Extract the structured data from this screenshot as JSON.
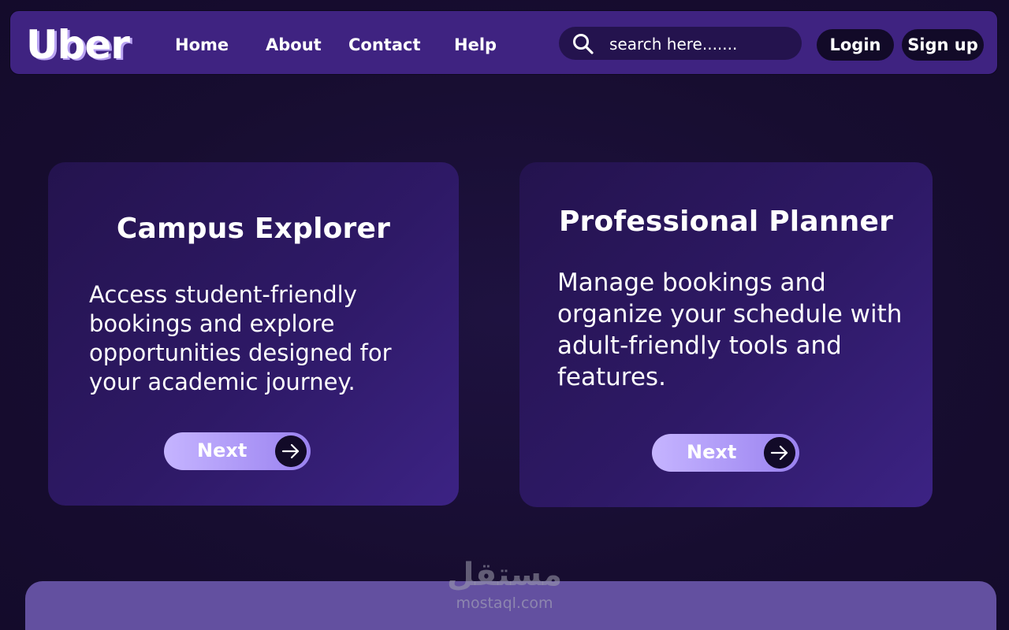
{
  "header": {
    "logo": "Uber",
    "nav": [
      "Home",
      "About",
      "Contact",
      "Help"
    ],
    "search": {
      "placeholder": "search here.......",
      "icon": "search-icon"
    },
    "login_label": "Login",
    "signup_label": "Sign up"
  },
  "cards": [
    {
      "title": "Campus Explorer",
      "text": "Access student-friendly bookings and explore opportunities designed for your academic journey.",
      "button_label": "Next",
      "button_icon": "arrow-right-icon"
    },
    {
      "title": "Professional Planner",
      "text": "Manage bookings and organize your schedule with adult-friendly tools and features.",
      "button_label": "Next",
      "button_icon": "arrow-right-icon"
    }
  ],
  "watermark": {
    "arabic": "مستقل",
    "url": "mostaql.com"
  },
  "colors": {
    "background": "#170d30",
    "navbar": "#3f2381",
    "card": "#2e1966",
    "button": "#b39fff",
    "bottom_panel": "#6350a0"
  }
}
